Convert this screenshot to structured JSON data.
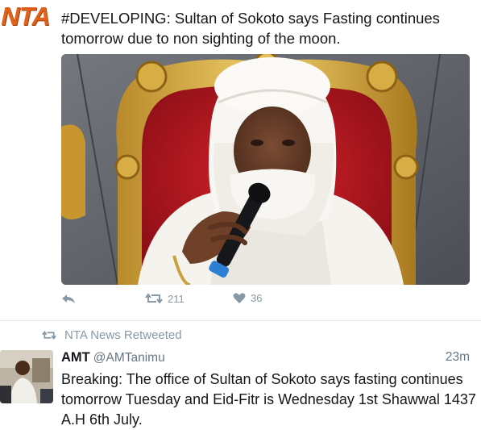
{
  "tweet1": {
    "text": "#DEVELOPING: Sultan of Sokoto says Fasting continues tomorrow due to non sighting of the moon.",
    "actions": {
      "retweets": "211",
      "likes": "36"
    }
  },
  "retweet_context": {
    "label": "NTA News Retweeted"
  },
  "tweet2": {
    "name": "AMT",
    "handle": "@AMTanimu",
    "time": "23m",
    "text": "Breaking: The office of Sultan of Sokoto says fasting continues tomorrow Tuesday and Eid-Fitr is Wednesday 1st Shawwal 1437 A.H 6th July."
  },
  "colors": {
    "icon_gray": "#8899a6",
    "text_primary": "#14171a",
    "text_secondary": "#657786",
    "nta_orange": "#e0611a"
  },
  "icons": [
    "reply-icon",
    "retweet-icon",
    "heart-icon",
    "retweet-context-icon"
  ],
  "logo_text": "NTA"
}
